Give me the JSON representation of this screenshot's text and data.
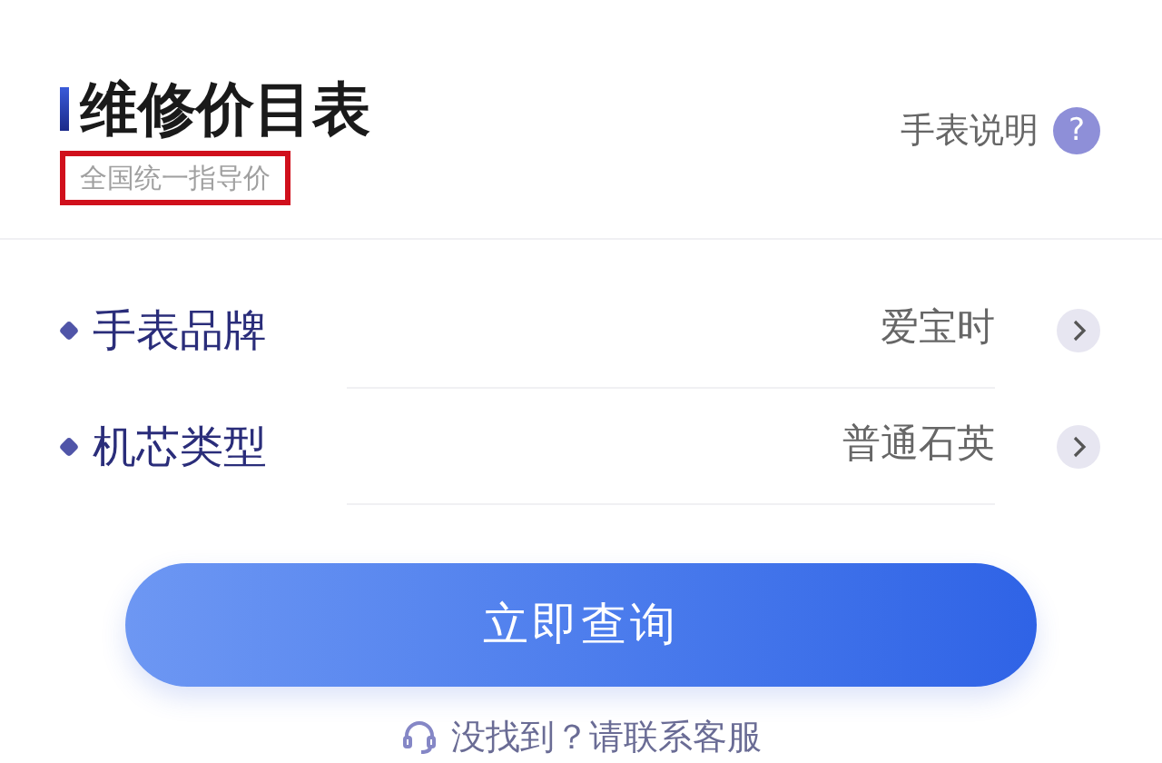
{
  "header": {
    "title": "维修价目表",
    "subtitle": "全国统一指导价",
    "subtitle_highlighted": true,
    "help_link": "手表说明",
    "help_icon": "?"
  },
  "fields": [
    {
      "label": "手表品牌",
      "value": "爱宝时"
    },
    {
      "label": "机芯类型",
      "value": "普通石英"
    }
  ],
  "query_button": "立即查询",
  "contact_link": "没找到？请联系客服"
}
